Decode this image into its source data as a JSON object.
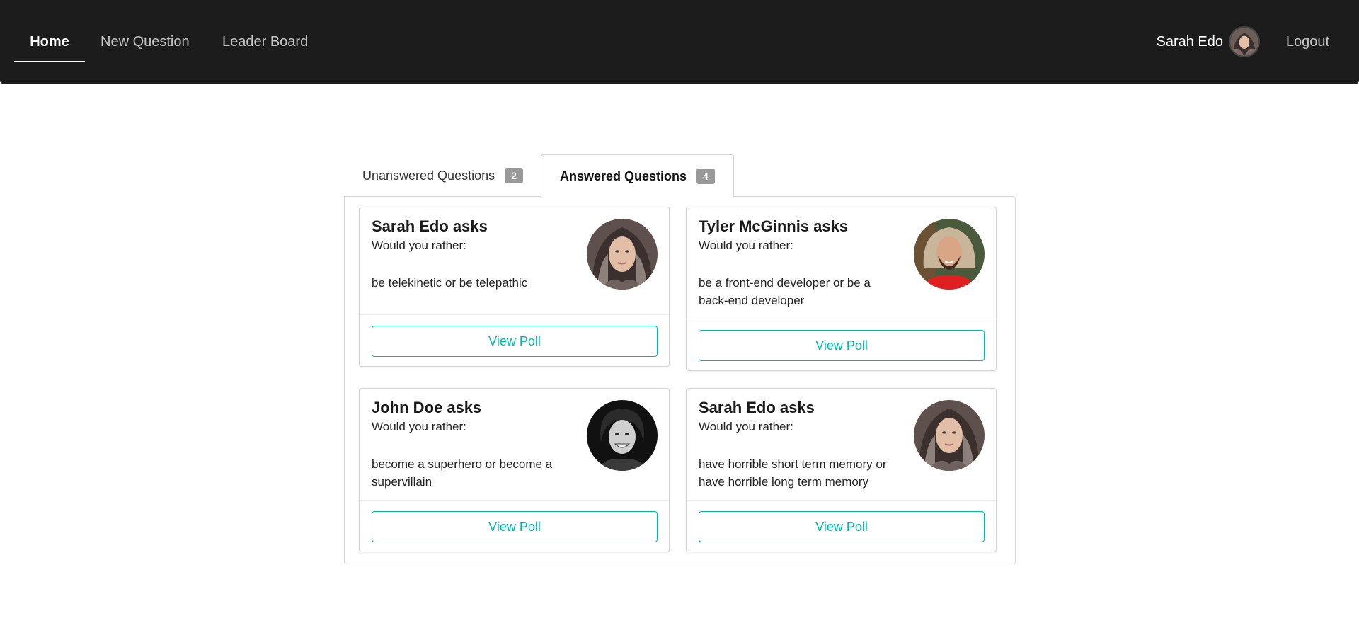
{
  "nav": {
    "home": "Home",
    "new_question": "New Question",
    "leader_board": "Leader Board",
    "user_name": "Sarah Edo",
    "logout": "Logout"
  },
  "tabs": [
    {
      "label": "Unanswered Questions",
      "count": "2"
    },
    {
      "label": "Answered Questions",
      "count": "4",
      "active": true
    }
  ],
  "cards": [
    {
      "title": "Sarah Edo asks",
      "subtitle": "Would you rather:",
      "question": "be telekinetic or be telepathic",
      "button": "View Poll",
      "avatar": "sarah-edo-avatar"
    },
    {
      "title": "Tyler McGinnis asks",
      "subtitle": "Would you rather:",
      "question": "be a front-end developer or be a back-end developer",
      "button": "View Poll",
      "avatar": "tyler-mcginnis-avatar"
    },
    {
      "title": "John Doe asks",
      "subtitle": "Would you rather:",
      "question": "become a superhero or become a supervillain",
      "button": "View Poll",
      "avatar": "john-doe-avatar"
    },
    {
      "title": "Sarah Edo asks",
      "subtitle": "Would you rather:",
      "question": "have horrible short term memory or have horrible long term memory",
      "button": "View Poll",
      "avatar": "sarah-edo-avatar"
    }
  ],
  "colors": {
    "navbar": "#1c1c1d",
    "accent": "#00b5ad",
    "badge": "#999999"
  }
}
